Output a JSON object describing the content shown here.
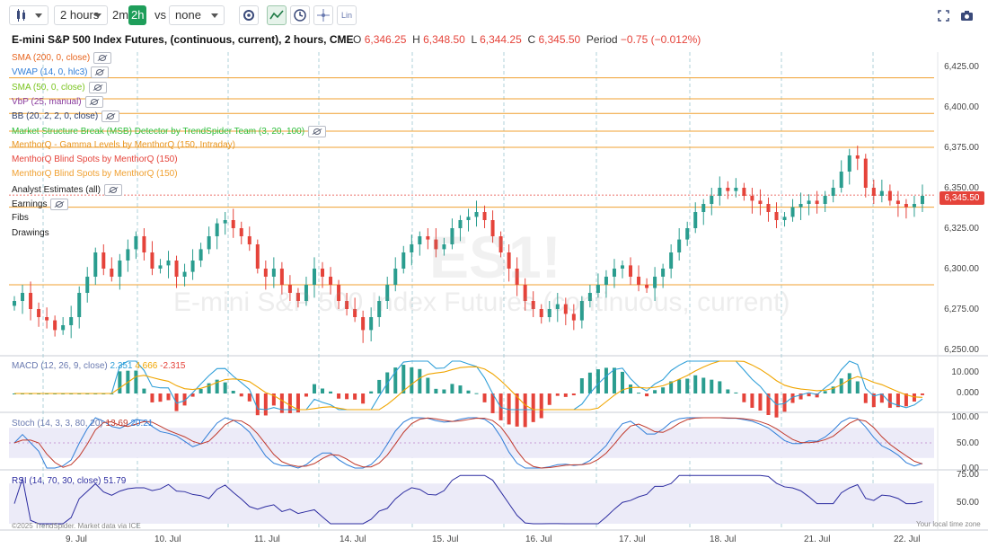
{
  "toolbar": {
    "interval": "2 hours",
    "quick_interval_1": "2m",
    "quick_interval_2": "2h",
    "vs_label": "vs",
    "compare": "none",
    "lin_label": "Lin"
  },
  "header": {
    "title": "E-mini S&P 500 Index Futures, (continuous, current), 2 hours, CME",
    "open_label": "O",
    "open": "6,346.25",
    "high_label": "H",
    "high": "6,348.50",
    "low_label": "L",
    "low": "6,344.25",
    "close_label": "C",
    "close": "6,345.50",
    "period_label": "Period",
    "period": "−0.75 (−0.012%)"
  },
  "indicators": [
    {
      "label": "SMA (200, 0, close)",
      "color": "#e8651f"
    },
    {
      "label": "VWAP (14, 0, hlc3)",
      "color": "#2f7ed8"
    },
    {
      "label": "SMA (50, 0, close)",
      "color": "#7ac41f"
    },
    {
      "label": "VbP (25, manual)",
      "color": "#8a3c9e"
    },
    {
      "label": "BB (20, 2, 2, 0, close)",
      "color": "#2c3e6a"
    },
    {
      "label": "Market Structure Break (MSB) Detector by TrendSpider Team (3, 20, 100)",
      "color": "#2ebd3c"
    },
    {
      "label": "MenthorQ - Gamma Levels by MenthorQ (150, Intraday)",
      "color": "#e8951f"
    },
    {
      "label": "MenthorQ Blind Spots by MenthorQ (150)",
      "color": "#e5433a"
    },
    {
      "label": "MenthorQ Blind Spots by MenthorQ (150)",
      "color": "#f0a030"
    },
    {
      "label": "Analyst Estimates (all)",
      "color": "#222222"
    },
    {
      "label": "Earnings",
      "color": "#222222"
    },
    {
      "label": "Fibs",
      "color": "#222222"
    },
    {
      "label": "Drawings",
      "color": "#222222"
    }
  ],
  "watermark": {
    "symbol": "ES1!",
    "name": "E-mini S&P 500 Index Futures (continuous, current)"
  },
  "price_axis": {
    "ticks": [
      "6,425.00",
      "6,400.00",
      "6,375.00",
      "6,350.00",
      "6,325.00",
      "6,300.00",
      "6,275.00",
      "6,250.00"
    ],
    "current_price": "6,345.50"
  },
  "macd": {
    "label": "MACD (12, 26, 9, close)",
    "macd_value": "2.351",
    "signal_value": "4.666",
    "hist_value": "-2.315",
    "ticks": [
      "10.000",
      "0.000"
    ]
  },
  "stoch": {
    "label": "Stoch (14, 3, 3, 80, 20)",
    "k_value": "13.69",
    "d_value": "20.21",
    "ticks": [
      "100.00",
      "50.00",
      "0.00"
    ]
  },
  "rsi": {
    "label": "RSI (14, 70, 30, close)",
    "value": "51.79",
    "ticks": [
      "75.00",
      "50.00"
    ]
  },
  "dates": [
    "9. Jul",
    "10. Jul",
    "11. Jul",
    "14. Jul",
    "15. Jul",
    "16. Jul",
    "17. Jul",
    "18. Jul",
    "21. Jul",
    "22. Jul"
  ],
  "footer": {
    "copyright": "©2025 TrendSpider. Market data via ICE",
    "timezone": "Your local time zone"
  },
  "colors": {
    "up": "#2a9d8f",
    "down": "#e5433a",
    "macd_line": "#2f9fd8",
    "signal_line": "#f0a500",
    "stoch_k": "#2f7ed8",
    "stoch_d": "#c0392b",
    "rsi_line": "#2c2ca0",
    "level_line": "#f0a030"
  },
  "chart_data": {
    "type": "candlestick",
    "interval": "2 hours",
    "price_range": [
      6245,
      6430
    ],
    "horizontal_levels": [
      6418,
      6405,
      6396,
      6385,
      6375,
      6338,
      6290
    ],
    "current_price": 6345.5,
    "closes": [
      6280,
      6285,
      6275,
      6270,
      6268,
      6262,
      6265,
      6270,
      6285,
      6295,
      6310,
      6300,
      6295,
      6305,
      6312,
      6320,
      6310,
      6300,
      6302,
      6305,
      6295,
      6298,
      6305,
      6312,
      6320,
      6328,
      6330,
      6325,
      6320,
      6315,
      6300,
      6295,
      6300,
      6290,
      6285,
      6280,
      6290,
      6300,
      6295,
      6290,
      6280,
      6275,
      6270,
      6262,
      6270,
      6280,
      6290,
      6300,
      6310,
      6315,
      6320,
      6318,
      6312,
      6315,
      6325,
      6330,
      6332,
      6335,
      6330,
      6320,
      6310,
      6300,
      6290,
      6280,
      6275,
      6270,
      6275,
      6278,
      6272,
      6268,
      6280,
      6285,
      6290,
      6295,
      6300,
      6302,
      6295,
      6290,
      6288,
      6295,
      6300,
      6310,
      6318,
      6325,
      6335,
      6340,
      6345,
      6350,
      6348,
      6350,
      6345,
      6342,
      6340,
      6335,
      6330,
      6332,
      6338,
      6340,
      6342,
      6340,
      6345,
      6350,
      6360,
      6370,
      6368,
      6350,
      6345,
      6348,
      6342,
      6340,
      6338,
      6340,
      6345
    ],
    "macd": {
      "macd": 2.351,
      "signal": 4.666,
      "histogram": -2.315,
      "range": [
        -5,
        14
      ]
    },
    "stoch": {
      "k": 13.69,
      "d": 20.21,
      "range": [
        0,
        100
      ],
      "overbought": 80,
      "oversold": 20
    },
    "rsi": {
      "value": 51.79,
      "range": [
        25,
        80
      ],
      "overbought": 70,
      "oversold": 30
    }
  }
}
